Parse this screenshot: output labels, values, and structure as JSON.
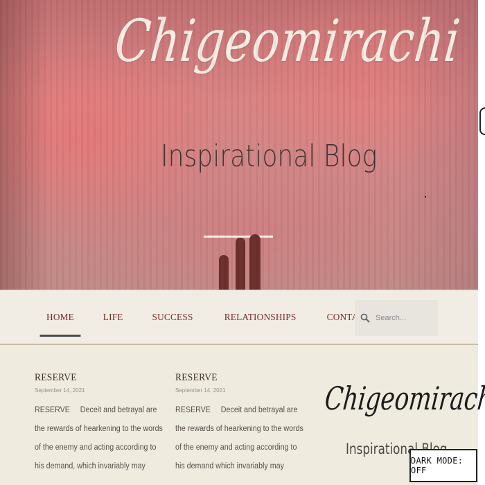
{
  "hero": {
    "brand": "Chigeomirachi",
    "tagline": "Inspirational Blog"
  },
  "nav": {
    "items": [
      {
        "label": "HOME",
        "active": true
      },
      {
        "label": "LIFE",
        "active": false
      },
      {
        "label": "SUCCESS",
        "active": false
      },
      {
        "label": "RELATIONSHIPS",
        "active": false
      },
      {
        "label": "CONTACT",
        "active": false
      }
    ]
  },
  "search": {
    "placeholder": "Search..."
  },
  "posts": [
    {
      "title": "RESERVE",
      "date": "September 14, 2021",
      "lead": "RESERVE",
      "excerpt": "Deceit and betrayal are the rewards of hearkening to the words of the enemy and acting according to his demand, which invariably may"
    },
    {
      "title": "RESERVE",
      "date": "September 14, 2021",
      "lead": "RESERVE",
      "excerpt": "Deceit and betrayal are the rewards of hearkening to the words of the enemy and acting according to his demand which invariably may"
    }
  ],
  "sidebar": {
    "brand": "Chigeomirachi",
    "tagline": "Inspirational Blog"
  },
  "dark_mode": {
    "label": "DARK MODE: OFF"
  },
  "colors": {
    "nav_text": "#7a2a2a",
    "page_bg": "#efebdf",
    "active_underline": "#4b4a55"
  }
}
